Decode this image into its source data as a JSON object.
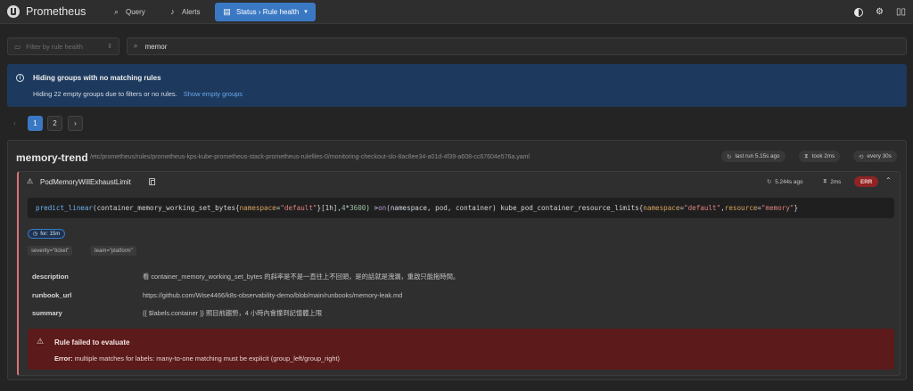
{
  "header": {
    "brand": "Prometheus",
    "nav": {
      "query": "Query",
      "alerts": "Alerts",
      "status": "Status › Rule health"
    }
  },
  "filters": {
    "rule_health_placeholder": "Filter by rule health",
    "search_value": "memor"
  },
  "banner": {
    "title": "Hiding groups with no matching rules",
    "message": "Hiding 22 empty groups due to filters or no rules.",
    "link": "Show empty groups"
  },
  "pagination": {
    "pages": [
      "1",
      "2"
    ],
    "current": "1"
  },
  "group": {
    "name": "memory-trend",
    "file": "/etc/prometheus/rules/prometheus-kps-kube-prometheus-stack-prometheus-rulefiles-0/monitoring-checkout-slo-8ac8ee34-a01d-4f39-a608-cc67604e576a.yaml",
    "last_run": "last run 5.15s ago",
    "took": "took 2ms",
    "interval": "every 30s"
  },
  "rule": {
    "name": "PodMemoryWillExhaustLimit",
    "eval_duration": "5.244s ago",
    "eval_took": "2ms",
    "health": "ERR",
    "expr": {
      "fn1": "predict_linear",
      "p1": "(container_memory_working_set_bytes{",
      "l1": "namespace",
      "eq1": "=",
      "s1": "\"default\"",
      "p2": "}[1h], ",
      "n1": "4",
      "op1": " * ",
      "n2": "3600",
      "p3": ") > ",
      "kw1": "on",
      "p4": " (namespace, pod, container) kube_pod_container_resource_limits{",
      "l2": "namespace",
      "eq2": "=",
      "s2": "\"default\"",
      "comma": ",",
      "l3": "resource",
      "eq3": "=",
      "s3": "\"memory\"",
      "p5": "}"
    },
    "for": "for: 15m",
    "labels": [
      "severity=\"ticket\"",
      "team=\"platform\""
    ],
    "annotations": [
      {
        "key": "description",
        "value": "看 container_memory_working_set_bytes 的斜率是不是一直往上不回頭，是的話就是洩漏，重啟只能拖時間。"
      },
      {
        "key": "runbook_url",
        "value": "https://github.com/Wise4466/k8s-observability-demo/blob/main/runbooks/memory-leak.md"
      },
      {
        "key": "summary",
        "value": "{{ $labels.container }} 照目前趨勢，4 小時內會撞到記憶體上限"
      }
    ],
    "error": {
      "title": "Rule failed to evaluate",
      "label": "Error:",
      "message": " multiple matches for labels: many-to-one matching must be explicit (group_left/group_right)"
    }
  },
  "colors": {
    "accent": "#3a78c4",
    "error_bg": "#5c1a1a",
    "err_badge": "#8e2424",
    "banner_bg": "#1d3a5e"
  }
}
